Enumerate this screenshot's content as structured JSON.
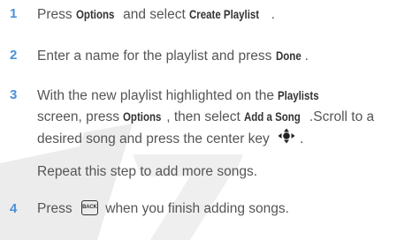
{
  "steps": [
    {
      "number": "1",
      "parts": [
        "Press ",
        "Options",
        " and select ",
        "Create Playlist",
        "."
      ]
    },
    {
      "number": "2",
      "parts": [
        "Enter a name for the playlist and press ",
        "Done",
        "."
      ]
    },
    {
      "number": "3",
      "line1": [
        "With the new playlist highlighted on the ",
        "Playlists"
      ],
      "line2": [
        "screen, press ",
        "Options",
        ", then select ",
        "Add a Song",
        ".Scroll to a"
      ],
      "line3": [
        "desired song and press the center key ",
        "."
      ],
      "line4": "Repeat this step to add more songs.",
      "nav_key_icon": "navigation-center-key-icon"
    },
    {
      "number": "4",
      "parts": [
        "Press ",
        " when you finish adding songs."
      ],
      "back_key_label": "BACK",
      "back_key_icon": "back-key-icon"
    }
  ],
  "colors": {
    "step_number": "#4a90d9",
    "body_text": "#555555",
    "keyword": "#333333",
    "watermark": "#e9e9e9"
  }
}
